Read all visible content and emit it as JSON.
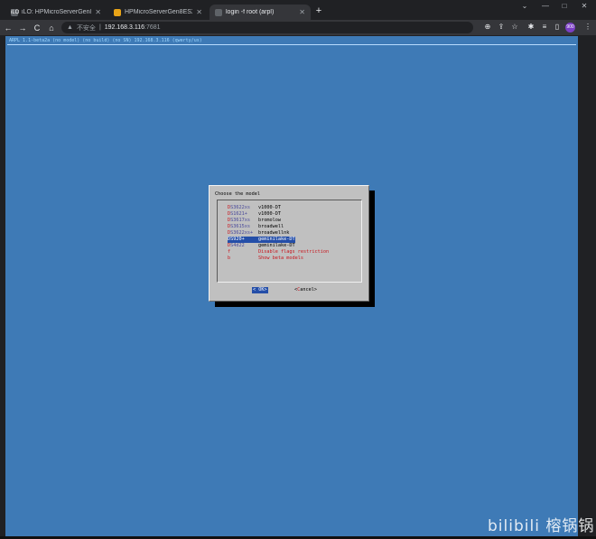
{
  "browser": {
    "tabs": [
      {
        "label": "iLO: HPMicroServerGen8ESXi",
        "favicon": "iLO",
        "active": false
      },
      {
        "label": "HPMicroServerGen8ESXi - VM",
        "favicon": "vm-icon",
        "active": false
      },
      {
        "label": "login -f root (arpl)",
        "favicon": "terminal-icon",
        "active": true
      }
    ],
    "new_tab": "+",
    "window_controls": [
      "⌄",
      "—",
      "□",
      "✕"
    ],
    "nav": {
      "back": "←",
      "forward": "→",
      "reload": "C",
      "home": "⌂"
    },
    "address": {
      "security": "不安全",
      "separator": "|",
      "host": "192.168.3.116",
      "port": ":7681"
    },
    "toolbar_icons": [
      "install-icon",
      "share-icon",
      "star-icon",
      "extensions-icon",
      "reading-list-icon",
      "sidepanel-icon",
      "profile-icon",
      "menu-icon"
    ],
    "avatar_text": "900"
  },
  "terminal": {
    "status_line": "ARPL 1.1-beta2a (no model) (no build) (no SN) 192.168.3.116 (qwerty/us)",
    "background": "#3e7ab6"
  },
  "dialog": {
    "title": "Choose the model",
    "items": [
      {
        "key": "D",
        "rest": "S3622xs",
        "desc": "v1000-DT",
        "style": "normal"
      },
      {
        "key": "D",
        "rest": "S1621+",
        "desc": "v1000-DT",
        "style": "normal"
      },
      {
        "key": "D",
        "rest": "S3617xs",
        "desc": "bromolow",
        "style": "normal"
      },
      {
        "key": "D",
        "rest": "S3615xs",
        "desc": "broadwell",
        "style": "normal"
      },
      {
        "key": "D",
        "rest": "S3622xs+",
        "desc": "broadwellnk",
        "style": "normal"
      },
      {
        "key": "D",
        "rest": "S920+",
        "desc": "geminilake-DT",
        "style": "selected"
      },
      {
        "key": "D",
        "rest": "S4d22",
        "desc": "geminilake-DT",
        "style": "normal"
      },
      {
        "key": "f",
        "rest": "",
        "desc": "Disable flags restriction",
        "style": "red"
      },
      {
        "key": "b",
        "rest": "",
        "desc": "Show beta models",
        "style": "red"
      }
    ],
    "ok": {
      "left": "<",
      "key": " ",
      "text": "OK",
      "right": ">"
    },
    "cancel": {
      "left": "<",
      "key": "C",
      "text": "ancel",
      "right": ">"
    }
  },
  "watermark": "bilibili 榕锅锅"
}
